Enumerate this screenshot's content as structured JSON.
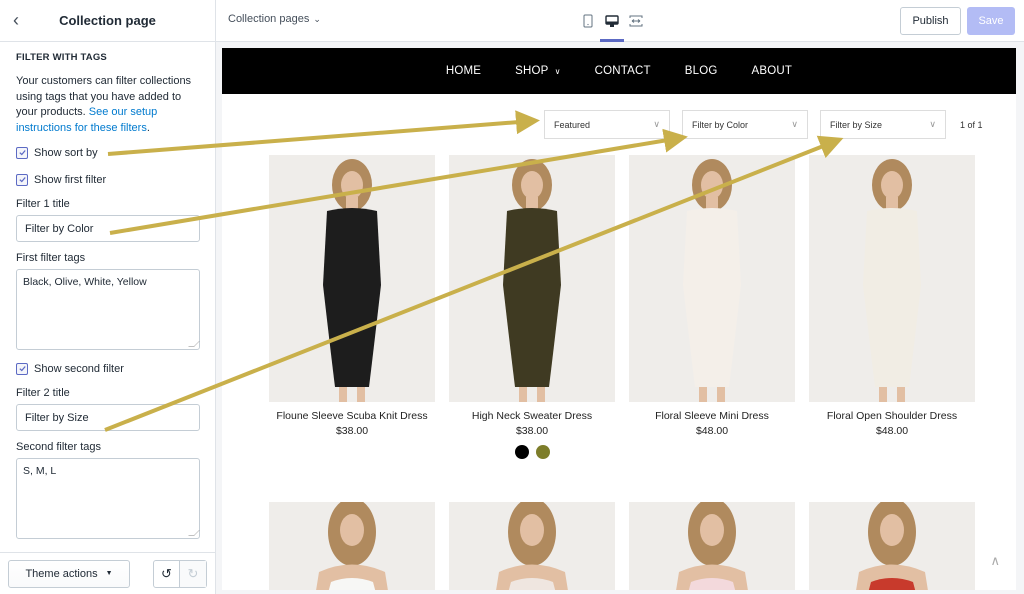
{
  "sidebar": {
    "title": "Collection page",
    "back_icon": "chevron-left-icon",
    "section_heading": "FILTER WITH TAGS",
    "description": "Your customers can filter collections using tags that you have added to your products. ",
    "description_link": "See our setup instructions for these filters",
    "description_end": ".",
    "show_sort_by": {
      "label": "Show sort by",
      "checked": true
    },
    "show_first_filter": {
      "label": "Show first filter",
      "checked": true
    },
    "filter1_title_label": "Filter 1 title",
    "filter1_title_value": "Filter by Color",
    "filter1_tags_label": "First filter tags",
    "filter1_tags_value": "Black, Olive, White, Yellow",
    "show_second_filter": {
      "label": "Show second filter",
      "checked": true
    },
    "filter2_title_label": "Filter 2 title",
    "filter2_title_value": "Filter by Size",
    "filter2_tags_label": "Second filter tags",
    "filter2_tags_value": "S, M, L",
    "footer": {
      "theme_actions_label": "Theme actions",
      "undo_icon": "undo-icon",
      "redo_icon": "redo-icon"
    }
  },
  "topbar": {
    "page_selector": "Collection pages",
    "devices": [
      "mobile",
      "desktop",
      "full-width"
    ],
    "active_device": "desktop",
    "publish_label": "Publish",
    "save_label": "Save"
  },
  "store": {
    "nav": [
      "HOME",
      "SHOP",
      "CONTACT",
      "BLOG",
      "ABOUT"
    ],
    "sort_value": "Featured",
    "filter1_value": "Filter by Color",
    "filter2_value": "Filter by Size",
    "pagination": "1 of 1",
    "products": [
      {
        "name": "Floune Sleeve Scuba Knit Dress",
        "price": "$38.00",
        "dress_color": "#1d1d1d",
        "swatches": []
      },
      {
        "name": "High Neck Sweater Dress",
        "price": "$38.00",
        "dress_color": "#3f3a22",
        "swatches": [
          "#000000",
          "#7d7d2a"
        ]
      },
      {
        "name": "Floral Sleeve Mini Dress",
        "price": "$48.00",
        "dress_color": "#f4efe9",
        "swatches": []
      },
      {
        "name": "Floral Open Shoulder Dress",
        "price": "$48.00",
        "dress_color": "#f1ede4",
        "swatches": []
      }
    ],
    "second_row_top_colors": [
      "#f7f7f5",
      "#efe6e0",
      "#f3d9dc",
      "#c83a2c"
    ]
  },
  "colors": {
    "accent": "#5c6ac4",
    "save_disabled": "#b3bcf5",
    "annotation_arrow": "#c9b04b",
    "link": "#007ace"
  }
}
